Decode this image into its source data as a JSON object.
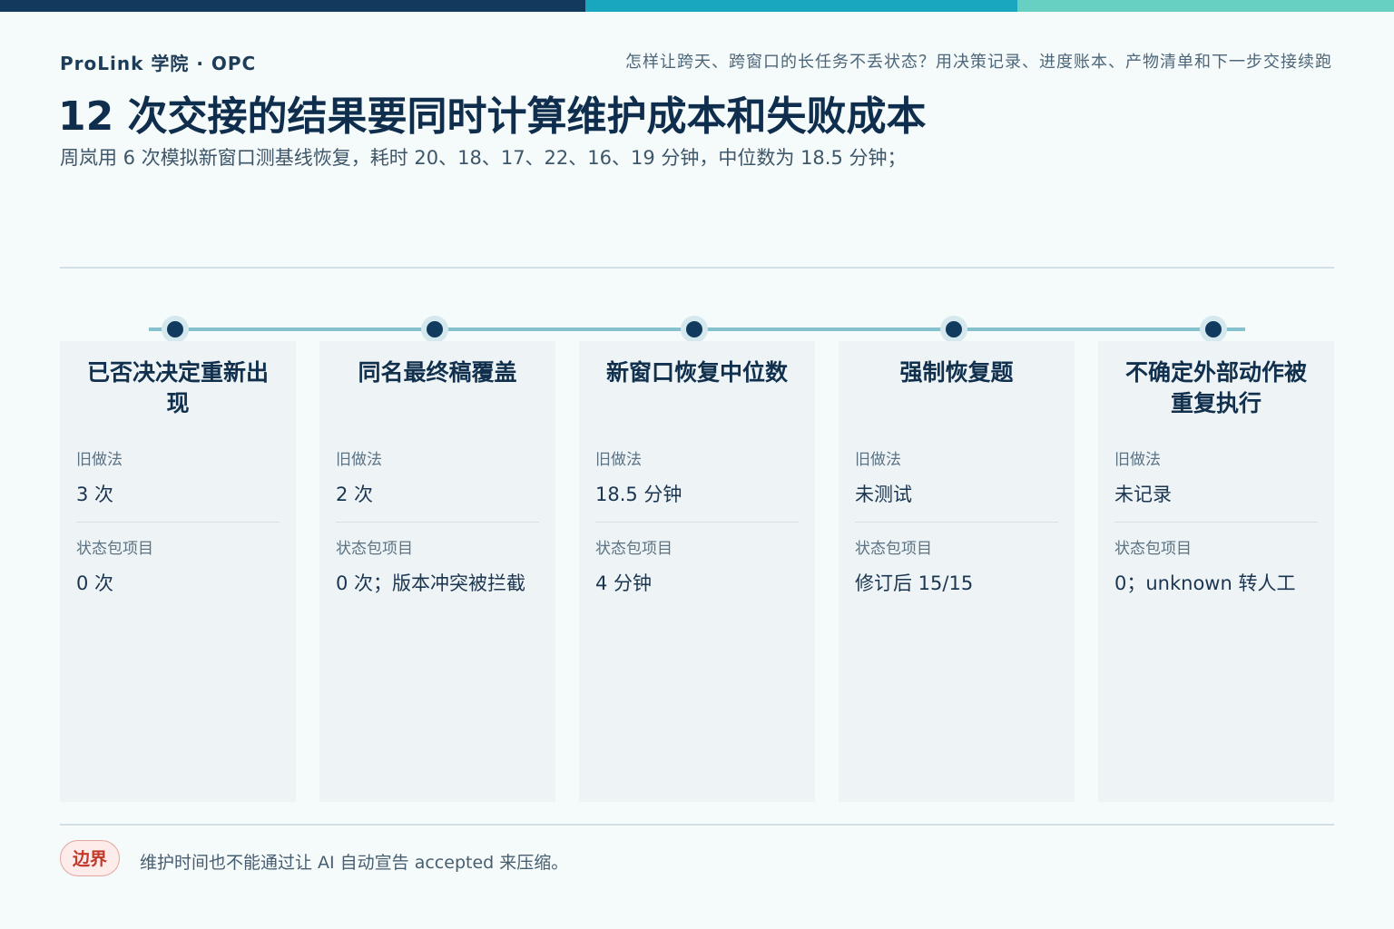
{
  "header": {
    "brand": "ProLink 学院 · OPC",
    "kicker": "怎样让跨天、跨窗口的长任务不丢状态？用决策记录、进度账本、产物清单和下一步交接续跑",
    "title": "12 次交接的结果要同时计算维护成本和失败成本",
    "subtitle": "周岚用 6 次模拟新窗口测基线恢复，耗时 20、18、17、22、16、19 分钟，中位数为 18.5 分钟；"
  },
  "cards": [
    {
      "title": "已否决决定重新出现",
      "old_label": "旧做法",
      "old_value": "3 次",
      "new_label": "状态包项目",
      "new_value": "0 次"
    },
    {
      "title": "同名最终稿覆盖",
      "old_label": "旧做法",
      "old_value": "2 次",
      "new_label": "状态包项目",
      "new_value": "0 次；版本冲突被拦截"
    },
    {
      "title": "新窗口恢复中位数",
      "old_label": "旧做法",
      "old_value": "18.5 分钟",
      "new_label": "状态包项目",
      "new_value": "4 分钟"
    },
    {
      "title": "强制恢复题",
      "old_label": "旧做法",
      "old_value": "未测试",
      "new_label": "状态包项目",
      "new_value": "修订后 15/15"
    },
    {
      "title": "不确定外部动作被重复执行",
      "old_label": "旧做法",
      "old_value": "未记录",
      "new_label": "状态包项目",
      "new_value": "0；unknown 转人工"
    }
  ],
  "footer": {
    "badge": "边界",
    "note": "维护时间也不能通过让 AI 自动宣告 accepted 来压缩。"
  },
  "colors": {
    "primary": "#123a5c",
    "teal": "#19a6bf",
    "mint": "#67d0c2",
    "badge_red": "#c0392b"
  }
}
